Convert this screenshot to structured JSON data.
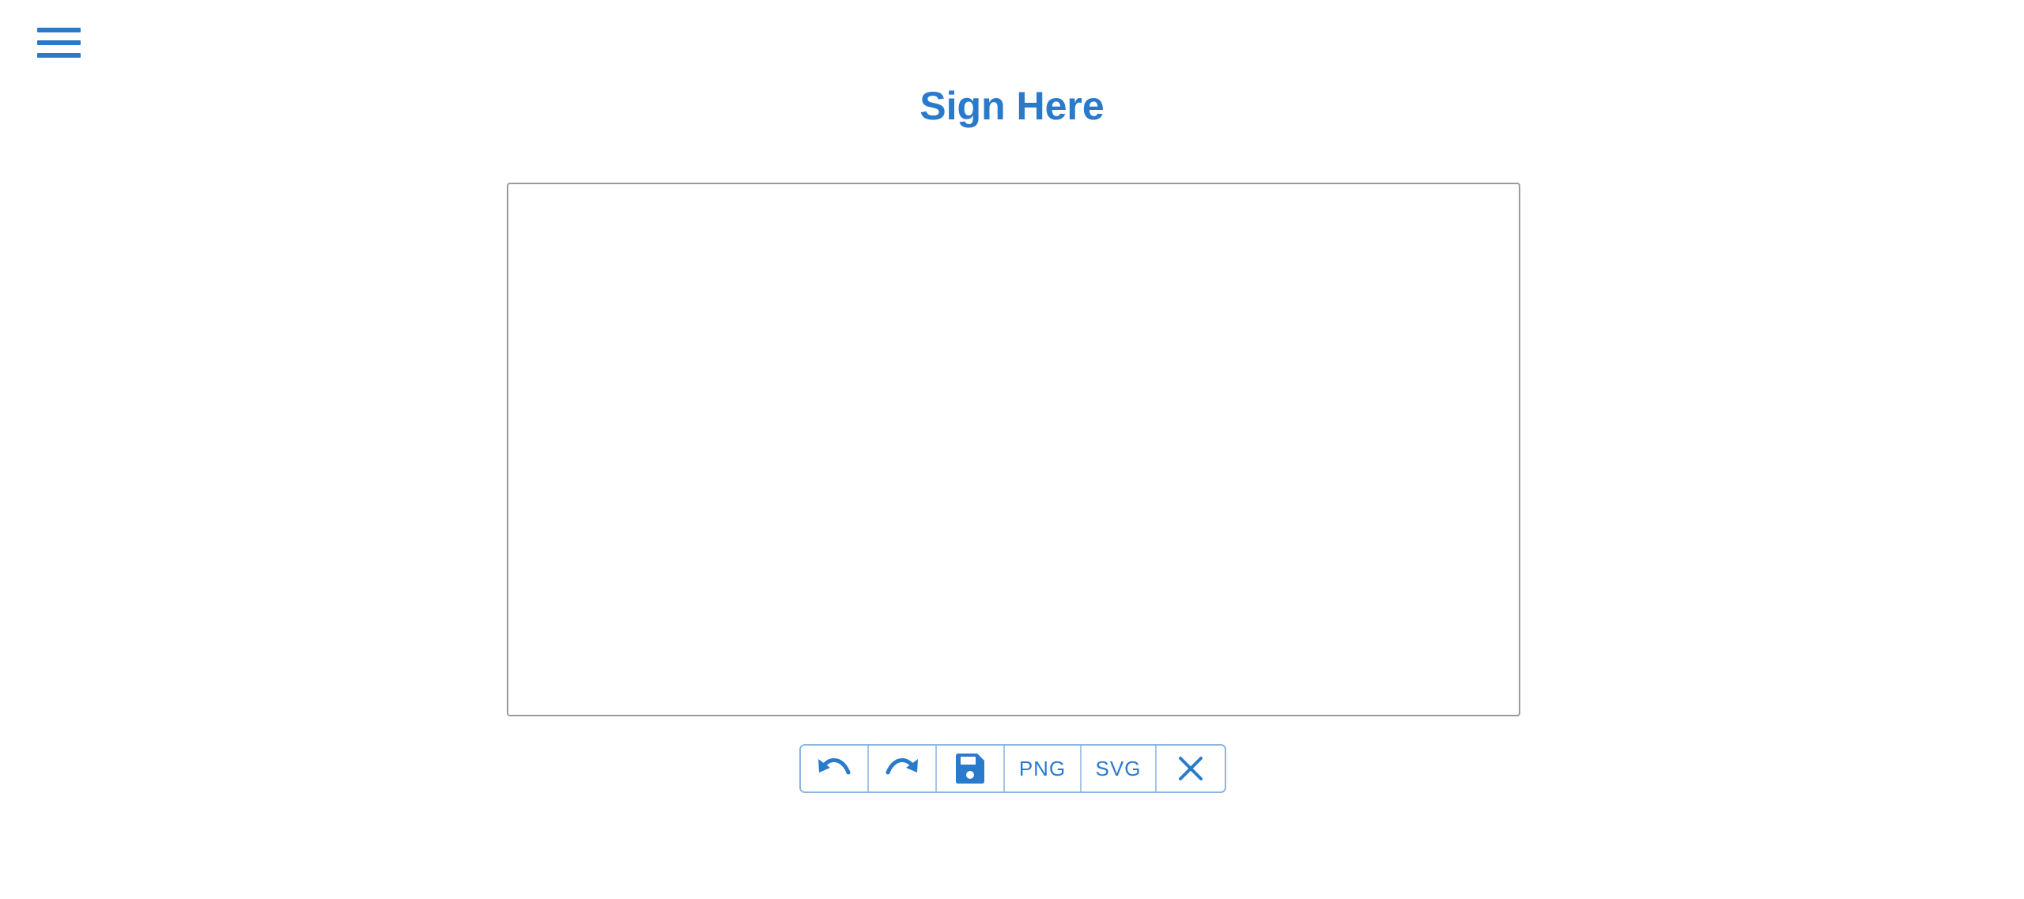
{
  "header": {
    "menu_icon": "hamburger-menu-icon",
    "title": "Sign Here"
  },
  "signature_pad": {
    "state": "empty"
  },
  "toolbar": {
    "undo_icon": "undo-icon",
    "redo_icon": "redo-icon",
    "save_icon": "floppy-disk-icon",
    "png_label": "PNG",
    "svg_label": "SVG",
    "clear_icon": "close-icon"
  },
  "colors": {
    "accent": "#2a7acb",
    "toolbar_border": "#8db6df",
    "canvas_border": "#9a9a9a",
    "background": "#ffffff"
  }
}
